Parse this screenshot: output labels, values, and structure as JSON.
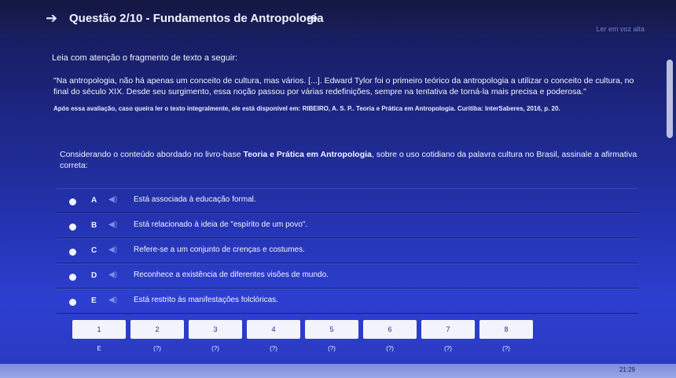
{
  "header": {
    "title": "Questão 2/10 - Fundamentos de Antropologia",
    "back_icon": "arrow-left-icon",
    "next_icon": "arrow-right-icon"
  },
  "listen_label": "Ler em voz alta",
  "instruction": "Leia com atenção o fragmento de texto a seguir:",
  "quote": "\"Na antropologia, não há apenas um conceito de cultura, mas vários. [...]. Edward Tylor foi o primeiro teórico da antropologia a utilizar o conceito de cultura, no final do século XIX. Desde seu surgimento, essa noção passou por várias redefinições, sempre na tentativa de torná-la mais precisa e poderosa.\"",
  "source": "Após essa avaliação, caso queira ler o texto integralmente, ele está disponível em: RIBEIRO, A. S. P.. Teoria e Prática em Antropologia. Curitiba: InterSaberes, 2016, p. 20.",
  "question": {
    "prefix": "Considerando o conteúdo abordado no livro-base ",
    "book": "Teoria e Prática em Antropologia",
    "suffix": ", sobre o uso cotidiano da palavra cultura no Brasil, assinale a afirmativa correta:"
  },
  "options": [
    {
      "letter": "A",
      "text": "Está associada à educação formal."
    },
    {
      "letter": "B",
      "text": "Está relacionado à ideia de \"espírito de um povo\"."
    },
    {
      "letter": "C",
      "text": "Refere-se a um conjunto de crenças e costumes."
    },
    {
      "letter": "D",
      "text": "Reconhece a existência de diferentes visões de mundo."
    },
    {
      "letter": "E",
      "text": "Está restrito às manifestações folclóricas."
    }
  ],
  "pager": {
    "pages": [
      "1",
      "2",
      "3",
      "4",
      "5",
      "6",
      "7",
      "8"
    ],
    "answers": [
      "E",
      "(?)",
      "(?)",
      "(?)",
      "(?)",
      "(?)",
      "(?)",
      "(?)"
    ]
  },
  "clock": "21:29",
  "colors": {
    "background_top": "#161a52",
    "background_bottom": "#2d3fd0",
    "speaker": "#7e8ff0",
    "page_button": "#f3f4fb"
  }
}
